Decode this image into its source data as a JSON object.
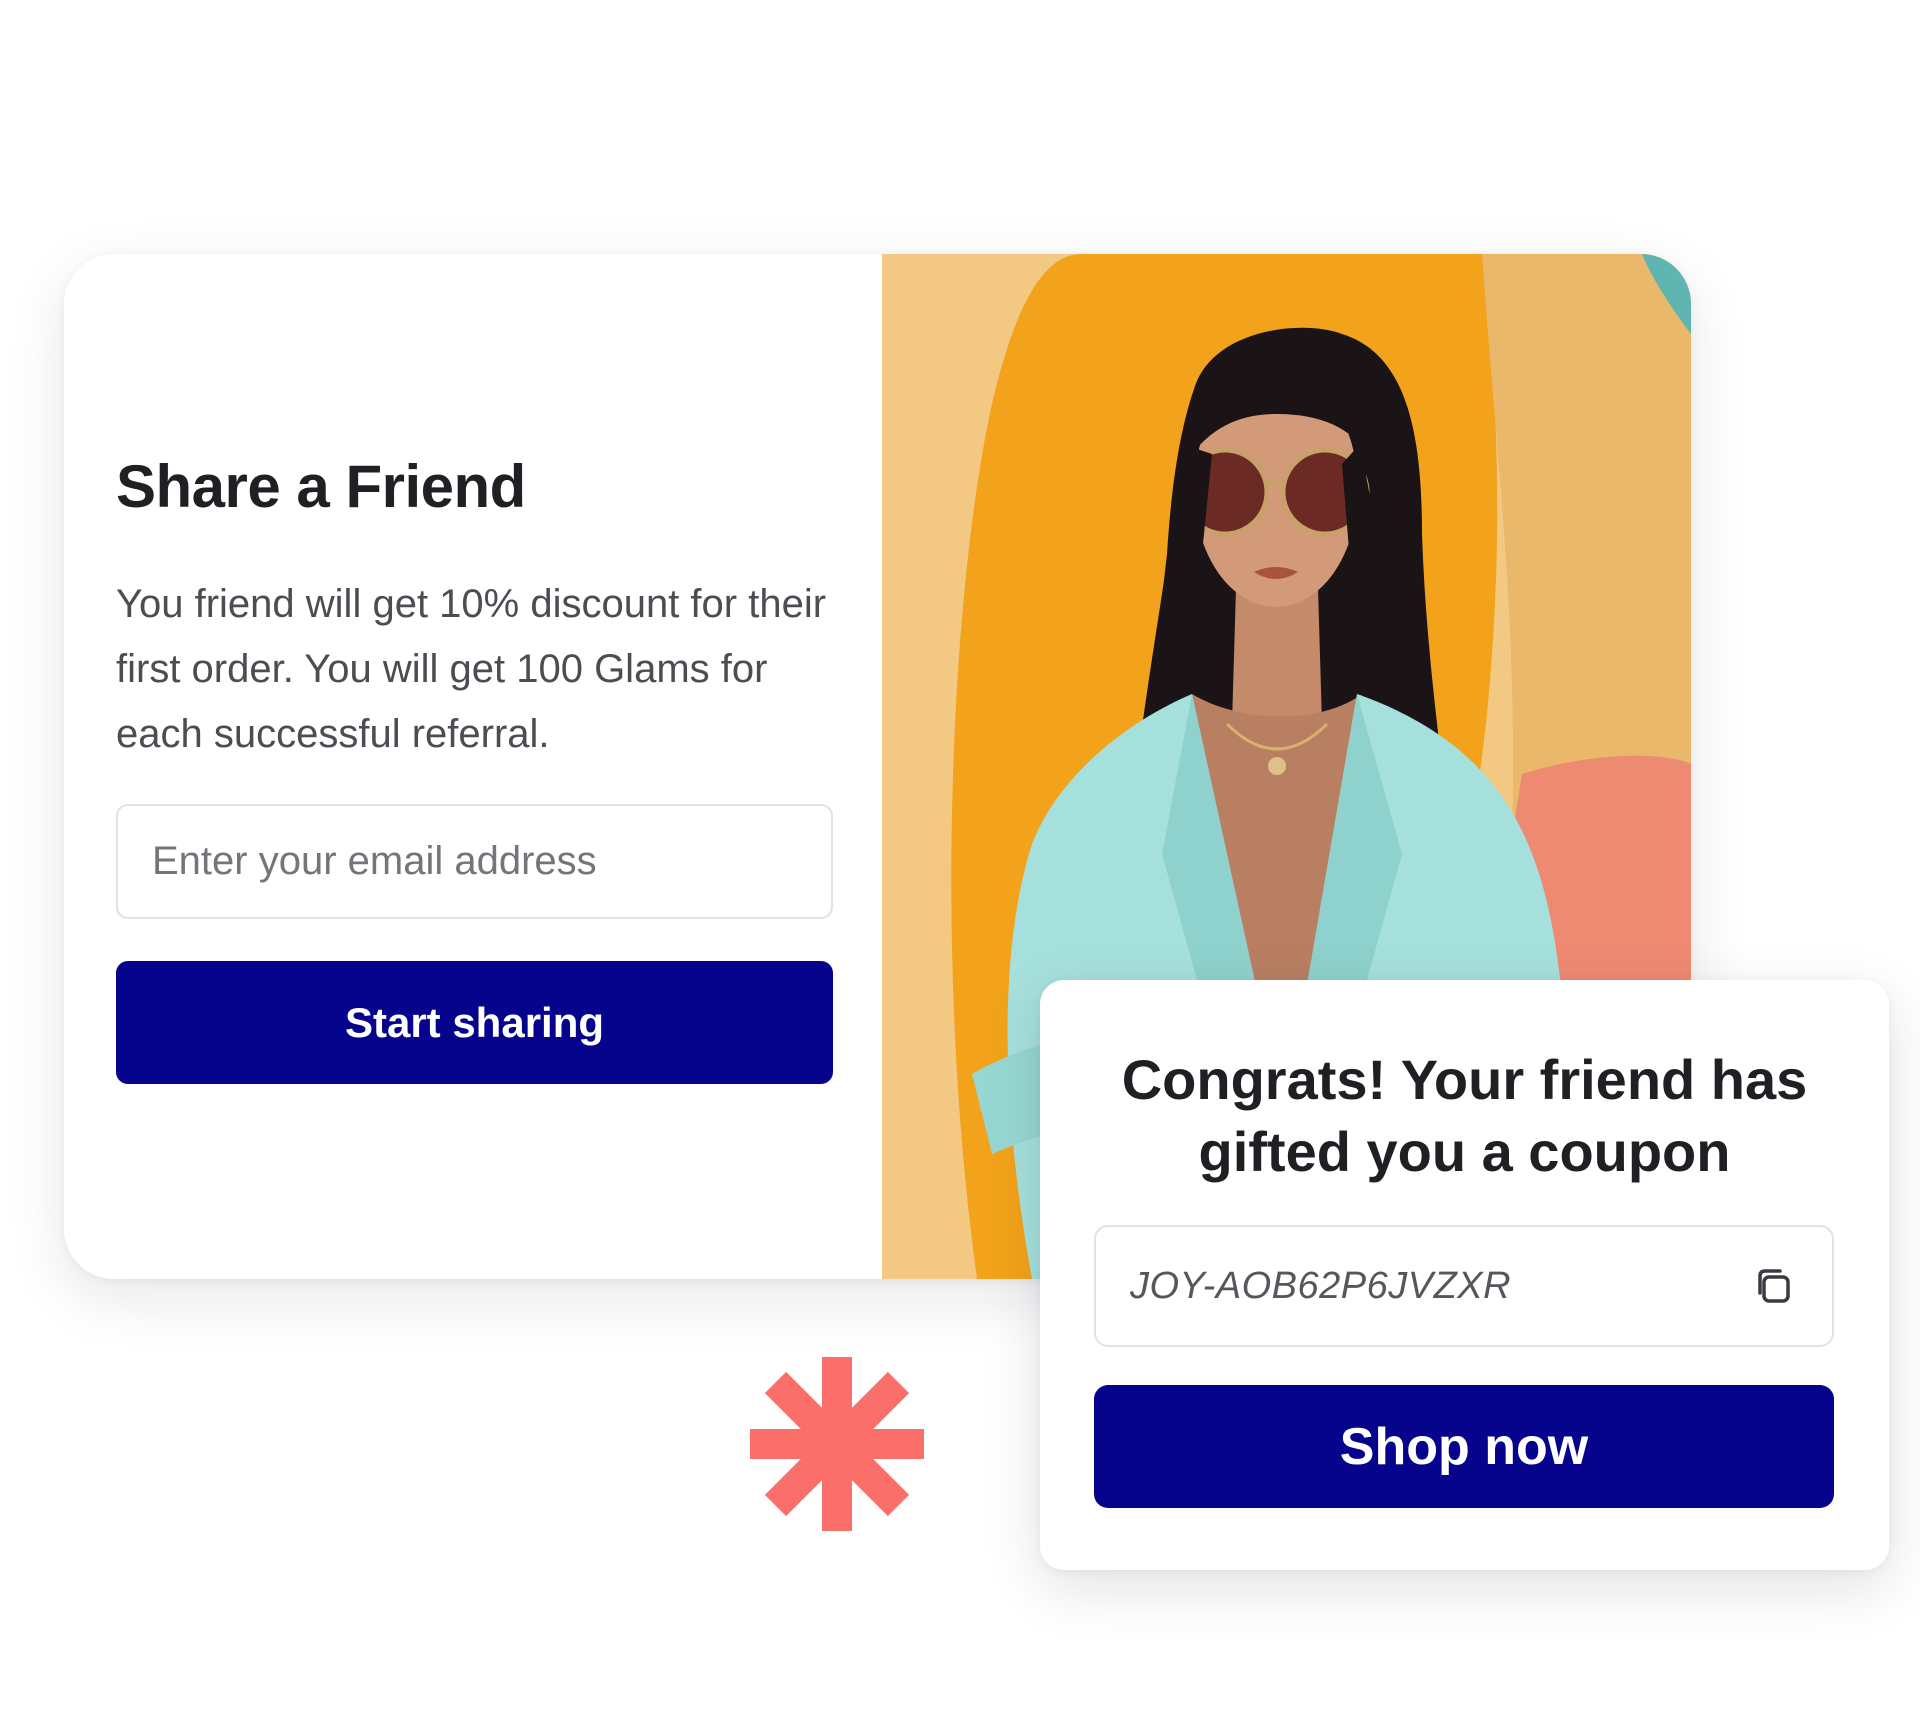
{
  "referral": {
    "title": "Share a Friend",
    "description": "You friend will get 10% discount for their first order. You will get 100 Glams for each successful referral.",
    "email_placeholder": "Enter your email address",
    "email_value": "",
    "button_label": "Start sharing"
  },
  "hero": {
    "image_semantic": "woman-in-sunglasses-and-turquoise-blazer"
  },
  "coupon": {
    "title": "Congrats! Your friend has gifted you a coupon",
    "code": "JOY-AOB62P6JVZXR",
    "copy_icon": "copy-icon",
    "button_label": "Shop now"
  },
  "colors": {
    "primary_button": "#06048c",
    "accent_coral": "#fb6f6a",
    "hero_orange": "#f2a31b",
    "hero_peach": "#f2c883",
    "blazer_turquoise": "#a6e0dc"
  }
}
